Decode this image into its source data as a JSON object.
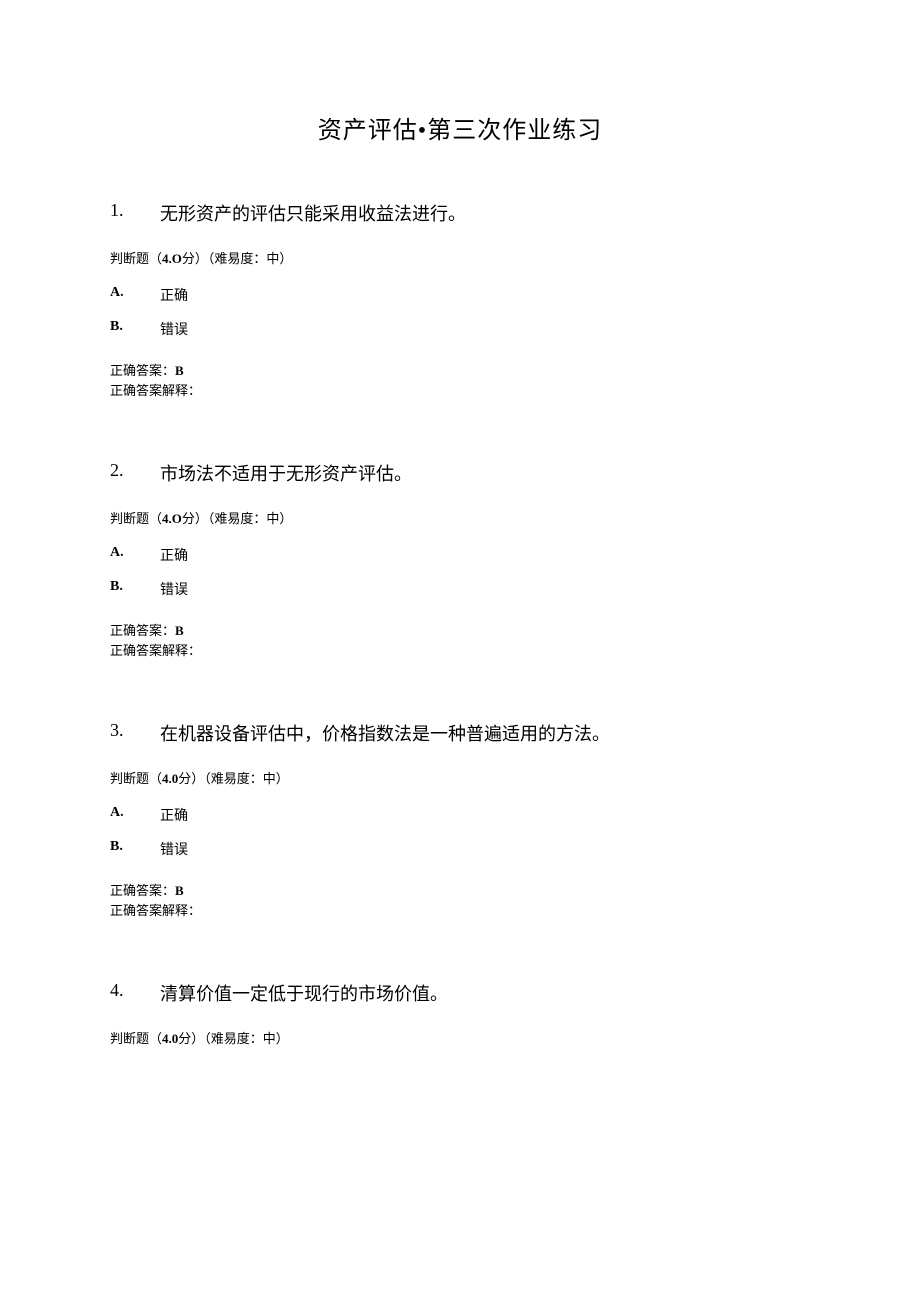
{
  "title": "资产评估•第三次作业练习",
  "meta_prefix": "判断题（",
  "points_bold": "4.O",
  "points_bold_alt": "4.0",
  "meta_suffix_1": "分）（难易度：中）",
  "option_labels": {
    "a": "A.",
    "b": "B."
  },
  "option_texts": {
    "correct": "正确",
    "wrong": "错误"
  },
  "answer_label": "正确答案：",
  "explain_label": "正确答案解释：",
  "questions": [
    {
      "num": "1.",
      "text": "无形资产的评估只能采用收益法进行。",
      "points": "4.O",
      "answer": "B",
      "explain": ""
    },
    {
      "num": "2.",
      "text": "市场法不适用于无形资产评估。",
      "points": "4.O",
      "answer": "B",
      "explain": ""
    },
    {
      "num": "3.",
      "text": "在机器设备评估中，价格指数法是一种普遍适用的方法。",
      "points": "4.0",
      "answer": "B",
      "explain": ""
    },
    {
      "num": "4.",
      "text": "清算价值一定低于现行的市场价值。",
      "points": "4.0",
      "answer": "",
      "explain": ""
    }
  ]
}
